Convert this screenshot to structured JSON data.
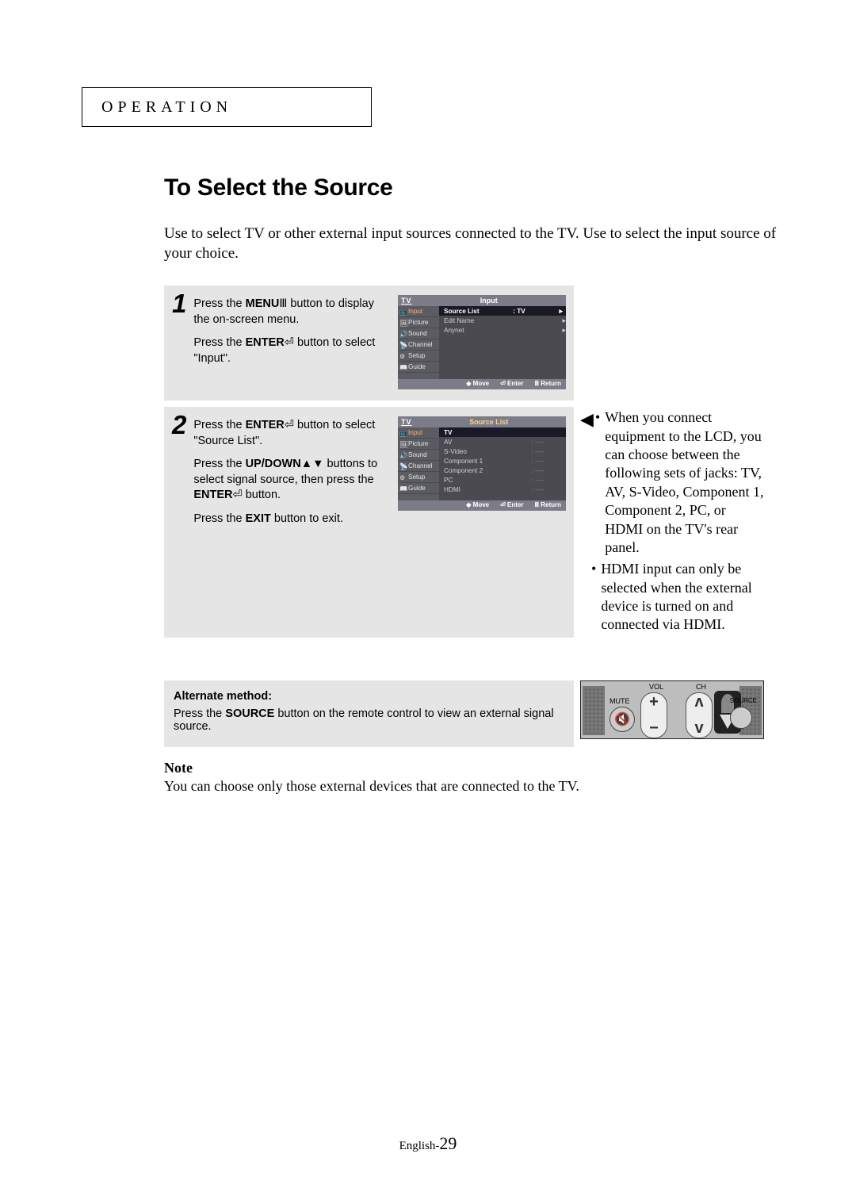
{
  "section": "OPERATION",
  "title": "To Select the Source",
  "intro": "Use to select TV or other external input sources connected to the TV. Use to select the input source of your choice.",
  "steps": [
    {
      "num": "1",
      "text_a_pre": "Press the ",
      "text_a_key": "MENU",
      "text_a_glyph": "Ⅲ",
      "text_a_post": " button to display the on-screen menu.",
      "text_b_pre": "Press the ",
      "text_b_key": "ENTER",
      "text_b_glyph": "⏎",
      "text_b_post": " button to select \"Input\"."
    },
    {
      "num": "2",
      "text_a_pre": "Press the ",
      "text_a_key": "ENTER",
      "text_a_glyph": "⏎",
      "text_a_post": " button to select \"Source List\".",
      "text_b_pre": "Press the ",
      "text_b_key": "UP/DOWN",
      "text_b_glyph": "▲▼",
      "text_b_post": " buttons to select signal source, then press the ",
      "text_b_key2": "ENTER",
      "text_b_glyph2": "⏎",
      "text_b_post2": " button.",
      "text_c_pre": "Press the ",
      "text_c_key": "EXIT",
      "text_c_post": " button to exit."
    }
  ],
  "osd": {
    "top_label": "TV",
    "side_items": [
      "Input",
      "Picture",
      "Sound",
      "Channel",
      "Setup",
      "Guide"
    ],
    "screen1": {
      "menu_title": "Input",
      "rows": [
        {
          "label": "Source List",
          "value": ": TV",
          "hl": true,
          "arrow": "▸"
        },
        {
          "label": "Edit Name",
          "value": "",
          "arrow": "▸"
        },
        {
          "label": "Anynet",
          "value": "",
          "arrow": "▸"
        }
      ]
    },
    "screen2": {
      "menu_title": "Source List",
      "rows": [
        {
          "label": "TV",
          "value": "",
          "hl": true
        },
        {
          "label": "AV",
          "value": ": ----"
        },
        {
          "label": "S-Video",
          "value": ": ----"
        },
        {
          "label": "Component 1",
          "value": ": ----"
        },
        {
          "label": "Component 2",
          "value": ": ----"
        },
        {
          "label": "PC",
          "value": ": ----"
        },
        {
          "label": "HDMI",
          "value": ": ----"
        }
      ]
    },
    "footer": {
      "move": "◆ Move",
      "enter": "⏎ Enter",
      "return": "Ⅲ Return"
    }
  },
  "side_note": {
    "bullets": [
      "When you connect equipment to the LCD, you can choose between the following sets of jacks: TV, AV, S-Video, Component 1, Component 2, PC, or HDMI on the TV's rear panel.",
      "HDMI input can only be selected when the external device is turned on and connected via HDMI."
    ],
    "lead_mark": "◀"
  },
  "alt": {
    "heading": "Alternate method:",
    "text_pre": "Press the ",
    "text_key": "SOURCE",
    "text_post": " button on the remote control to view an external signal source."
  },
  "remote": {
    "vol": "VOL",
    "ch": "CH",
    "mute": "MUTE",
    "source": "SOURCE",
    "plus": "+",
    "minus": "−",
    "up": "ʌ",
    "down": "v"
  },
  "note": {
    "heading": "Note",
    "text": "You can choose only those external devices that are connected to the TV."
  },
  "pagenum_prefix": "English-",
  "pagenum": "29"
}
